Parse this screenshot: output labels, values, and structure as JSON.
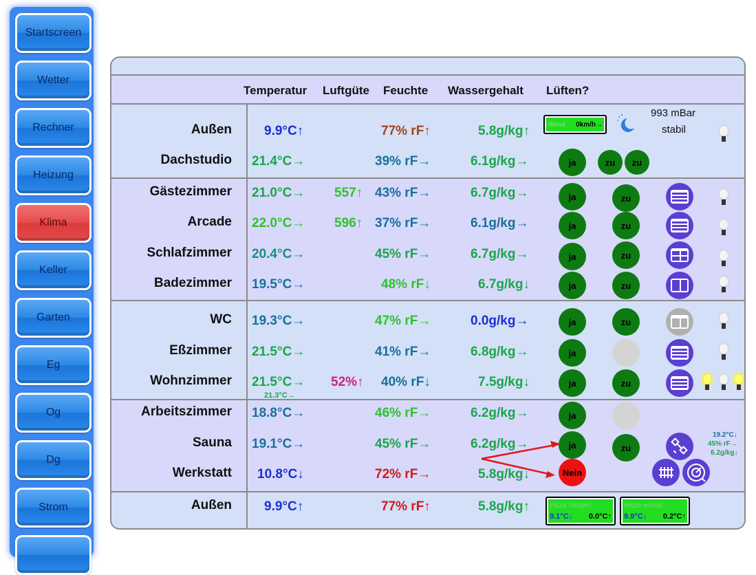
{
  "nav": [
    {
      "label": "Startscreen",
      "active": false
    },
    {
      "label": "Wetter",
      "active": false
    },
    {
      "label": "Rechner",
      "active": false
    },
    {
      "label": "Heizung",
      "active": false
    },
    {
      "label": "Klima",
      "active": true
    },
    {
      "label": "Keller",
      "active": false
    },
    {
      "label": "Garten",
      "active": false
    },
    {
      "label": "Eg",
      "active": false
    },
    {
      "label": "Og",
      "active": false
    },
    {
      "label": "Dg",
      "active": false
    },
    {
      "label": "Strom",
      "active": false
    }
  ],
  "columns": {
    "temperatur": "Temperatur",
    "luftguete": "Luftgüte",
    "feuchte": "Feuchte",
    "wassergehalt": "Wassergehalt",
    "lueften": "Lüften?"
  },
  "weather": {
    "pressure": "993 mBar",
    "trend": "stabil",
    "wind_label": "Wind",
    "wind_value": "0km/h→"
  },
  "rooms": {
    "aussen": {
      "name": "Außen",
      "temp": "9.9°C↑",
      "hum": "77% rF↑",
      "water": "5.8g/kg↑"
    },
    "dachstudio": {
      "name": "Dachstudio",
      "temp": "21.4°C→",
      "hum": "39% rF→",
      "water": "6.1g/kg→",
      "vent": "ja",
      "b1": "zu",
      "b2": "zu"
    },
    "gaeste": {
      "name": "Gästezimmer",
      "temp": "21.0°C→",
      "air": "557↑",
      "hum": "43% rF→",
      "water": "6.7g/kg→",
      "vent": "ja",
      "b1": "zu"
    },
    "arcade": {
      "name": "Arcade",
      "temp": "22.0°C→",
      "air": "596↑",
      "hum": "37% rF→",
      "water": "6.1g/kg→",
      "vent": "ja",
      "b1": "zu"
    },
    "schlaf": {
      "name": "Schlafzimmer",
      "temp": "20.4°C→",
      "hum": "45% rF→",
      "water": "6.7g/kg→",
      "vent": "ja",
      "b1": "zu"
    },
    "bad": {
      "name": "Badezimmer",
      "temp": "19.5°C→",
      "hum": "48% rF↓",
      "water": "6.7g/kg↓",
      "vent": "ja",
      "b1": "zu"
    },
    "wc": {
      "name": "WC",
      "temp": "19.3°C→",
      "hum": "47% rF→",
      "water": "0.0g/kg→",
      "vent": "ja",
      "b1": "zu"
    },
    "ess": {
      "name": "Eßzimmer",
      "temp": "21.5°C→",
      "hum": "41% rF→",
      "water": "6.8g/kg→",
      "vent": "ja"
    },
    "wohn": {
      "name": "Wohnzimmer",
      "temp": "21.5°C→",
      "subtemp": "21.3°C→",
      "air": "52%↑",
      "hum": "40% rF↓",
      "water": "7.5g/kg↓",
      "vent": "ja",
      "b1": "zu"
    },
    "arbeit": {
      "name": "Arbeitszimmer",
      "temp": "18.8°C→",
      "hum": "46% rF→",
      "water": "6.2g/kg→",
      "vent": "ja"
    },
    "sauna": {
      "name": "Sauna",
      "temp": "19.1°C→",
      "hum": "45% rF→",
      "water": "6.2g/kg→",
      "vent": "ja",
      "b1": "zu",
      "side_temp": "19.2°C↓",
      "side_hum": "45% rF→",
      "side_water": "6.2g/kg↓"
    },
    "werkstatt": {
      "name": "Werkstatt",
      "temp": "10.8°C↓",
      "hum": "72% rF→",
      "water": "5.8g/kg↓",
      "vent": "Nein"
    },
    "aussen2": {
      "name": "Außen",
      "temp": "9.9°C↑",
      "hum": "77% rF↑",
      "water": "5.8g/kg↑"
    }
  },
  "heat": {
    "hinten": {
      "label": "Hitze hinten:",
      "t1": "9.1°C↓",
      "t2": "0.0°C↑"
    },
    "vorne": {
      "label": "Hitze vorne:",
      "t1": "9.9°C↓",
      "t2": "0.2°C↑"
    }
  },
  "colors": {
    "blue": "#1d2fd0",
    "teal": "#1a6f9a",
    "green": "#1aa64a",
    "brown": "#a5441a",
    "red": "#d21a1a",
    "magenta": "#d4207a",
    "lime": "#2fc12f"
  }
}
